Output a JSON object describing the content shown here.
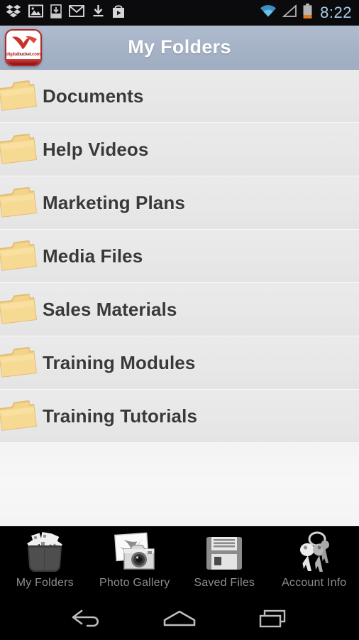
{
  "statusbar": {
    "time": "8:22",
    "left_icons": [
      {
        "name": "dropbox-icon"
      },
      {
        "name": "photo-icon"
      },
      {
        "name": "download-to-device-icon"
      },
      {
        "name": "gmail-icon"
      },
      {
        "name": "download-icon"
      },
      {
        "name": "play-store-icon"
      }
    ],
    "right_icons": [
      {
        "name": "wifi-icon"
      },
      {
        "name": "signal-icon"
      },
      {
        "name": "battery-icon"
      }
    ]
  },
  "header": {
    "title": "My Folders",
    "logo": {
      "name": "digitalbucket-logo",
      "word_light": "digital",
      "word_dark": "bucket",
      "word_tld": ".com"
    }
  },
  "list": {
    "items": [
      {
        "label": "Documents",
        "icon": "folder-icon"
      },
      {
        "label": "Help Videos",
        "icon": "folder-icon"
      },
      {
        "label": "Marketing Plans",
        "icon": "folder-icon"
      },
      {
        "label": "Media Files",
        "icon": "folder-icon"
      },
      {
        "label": "Sales Materials",
        "icon": "folder-icon"
      },
      {
        "label": "Training Modules",
        "icon": "folder-icon"
      },
      {
        "label": "Training Tutorials",
        "icon": "folder-icon"
      }
    ]
  },
  "tabbar": {
    "tabs": [
      {
        "label": "My Folders",
        "icon": "bucket-of-documents-icon",
        "active": true
      },
      {
        "label": "Photo Gallery",
        "icon": "camera-icon",
        "active": false
      },
      {
        "label": "Saved Files",
        "icon": "floppy-disk-icon",
        "active": false
      },
      {
        "label": "Account Info",
        "icon": "keys-icon",
        "active": false
      }
    ]
  },
  "navbar": {
    "buttons": [
      {
        "name": "back-icon"
      },
      {
        "name": "home-icon"
      },
      {
        "name": "recents-icon"
      }
    ]
  },
  "colors": {
    "header_bg": "#a5b2c6",
    "folder_yellow": "#f2d184",
    "row_bg": "#e8e8e8",
    "row_text": "#393939",
    "tab_label": "#8d8d8d",
    "clock": "#a9cbe8",
    "battery_low": "#e07b1e",
    "brand_red": "#b42a28"
  }
}
